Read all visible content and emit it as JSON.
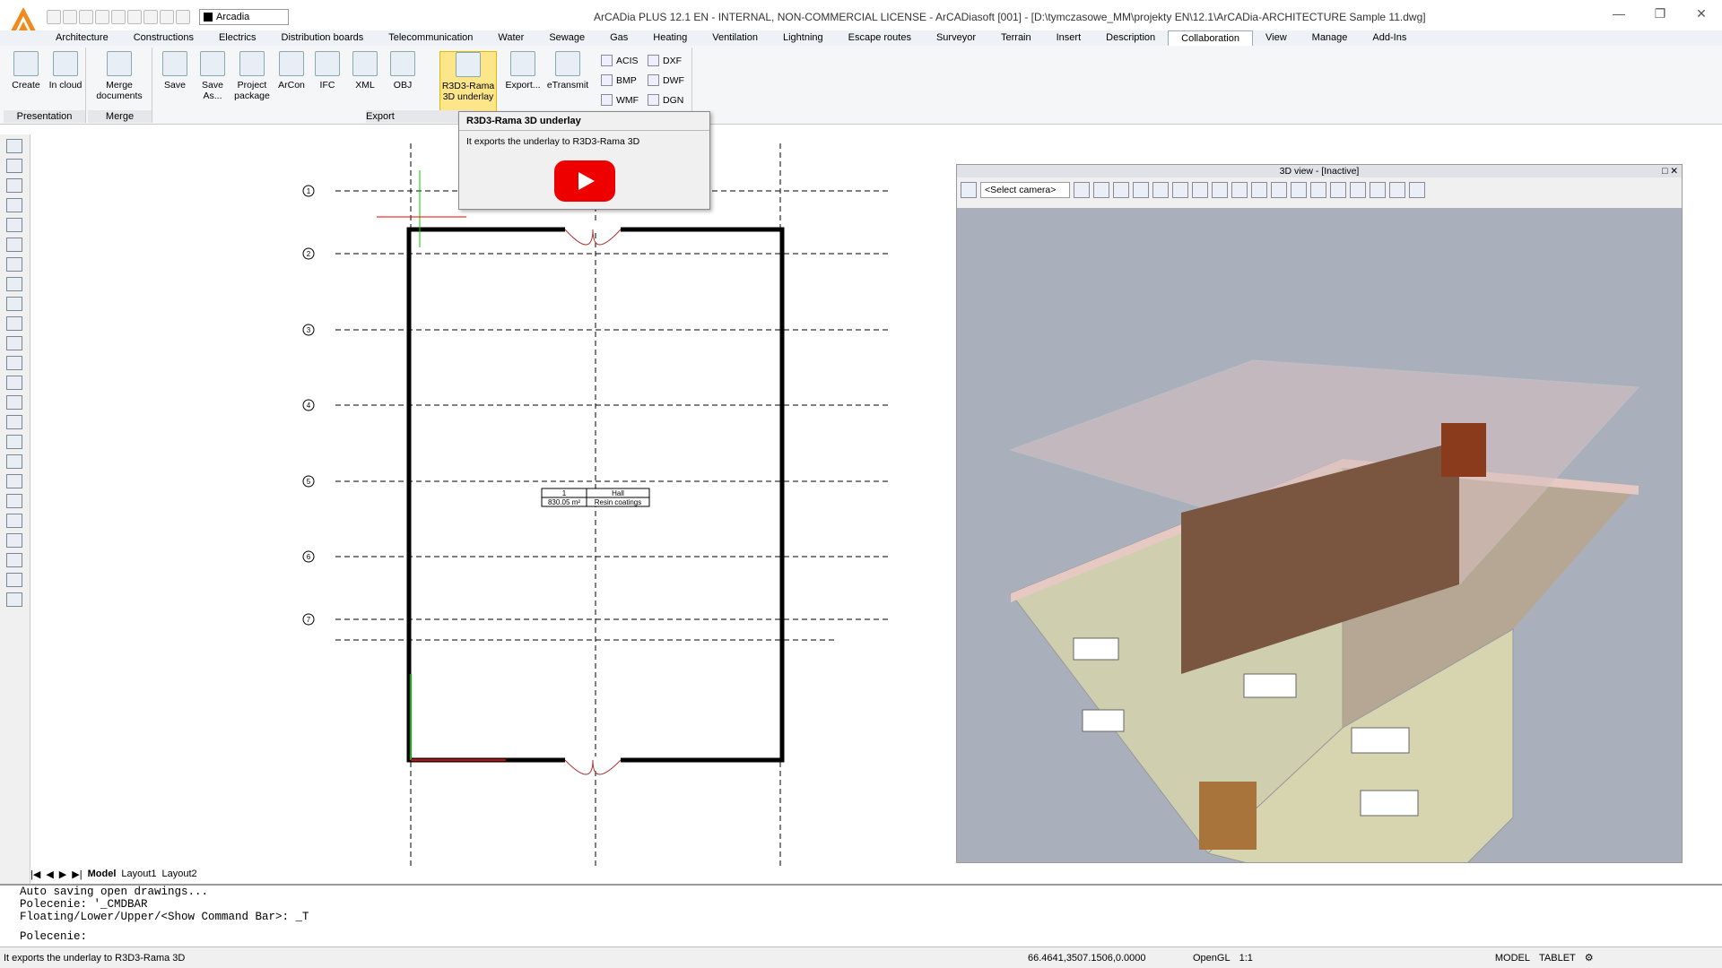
{
  "app": {
    "title": "ArCADia PLUS 12.1 EN - INTERNAL, NON-COMMERCIAL LICENSE - ArCADiasoft [001] - [D:\\tymczasowe_MM\\projekty EN\\12.1\\ArCADia-ARCHITECTURE Sample 11.dwg]",
    "layer": "Arcadia"
  },
  "menu": [
    "Architecture",
    "Constructions",
    "Electrics",
    "Distribution boards",
    "Telecommunication",
    "Water",
    "Sewage",
    "Gas",
    "Heating",
    "Ventilation",
    "Lightning",
    "Escape routes",
    "Surveyor",
    "Terrain",
    "Insert",
    "Description",
    "Collaboration",
    "View",
    "Manage",
    "Add-Ins"
  ],
  "ribbon": {
    "presentation": {
      "label": "Presentation",
      "create": "Create",
      "cloud": "In cloud"
    },
    "merge": {
      "label": "Merge",
      "merge_docs": "Merge documents"
    },
    "export": {
      "label": "Export",
      "save": "Save",
      "save_as": "Save As...",
      "project_package": "Project package",
      "arcon": "ArCon",
      "ifc": "IFC",
      "xml": "XML",
      "obj": "OBJ",
      "r3d3": "R3D3-Rama 3D underlay",
      "export": "Export...",
      "etransmit": "eTransmit",
      "acis": "ACIS",
      "bmp": "BMP",
      "wmf": "WMF",
      "dxf": "DXF",
      "dwf": "DWF",
      "dgn": "DGN"
    }
  },
  "tooltip": {
    "title": "R3D3-Rama 3D underlay",
    "desc": "It exports the underlay to R3D3-Rama 3D"
  },
  "view3d": {
    "title": "3D view - [Inactive]",
    "camera": "<Select camera>"
  },
  "plan": {
    "axes": [
      "1",
      "2",
      "3",
      "4",
      "5",
      "6",
      "7"
    ],
    "room_no": "1",
    "room_name": "Hall",
    "room_area": "830.05 m²",
    "room_floor": "Resin coatings"
  },
  "tabs": {
    "model": "Model",
    "layout1": "Layout1",
    "layout2": "Layout2"
  },
  "command": {
    "lines": [
      "Auto saving open drawings...",
      "Polecenie: '_CMDBAR",
      "Floating/Lower/Upper/<Show Command Bar>: _T"
    ],
    "prompt": "Polecenie:"
  },
  "status": {
    "message": "It exports the underlay to R3D3-Rama 3D",
    "coords": "66.4641,3507.1506,0.0000",
    "opengl": "OpenGL",
    "scale": "1:1",
    "model": "MODEL",
    "tablet": "TABLET"
  }
}
